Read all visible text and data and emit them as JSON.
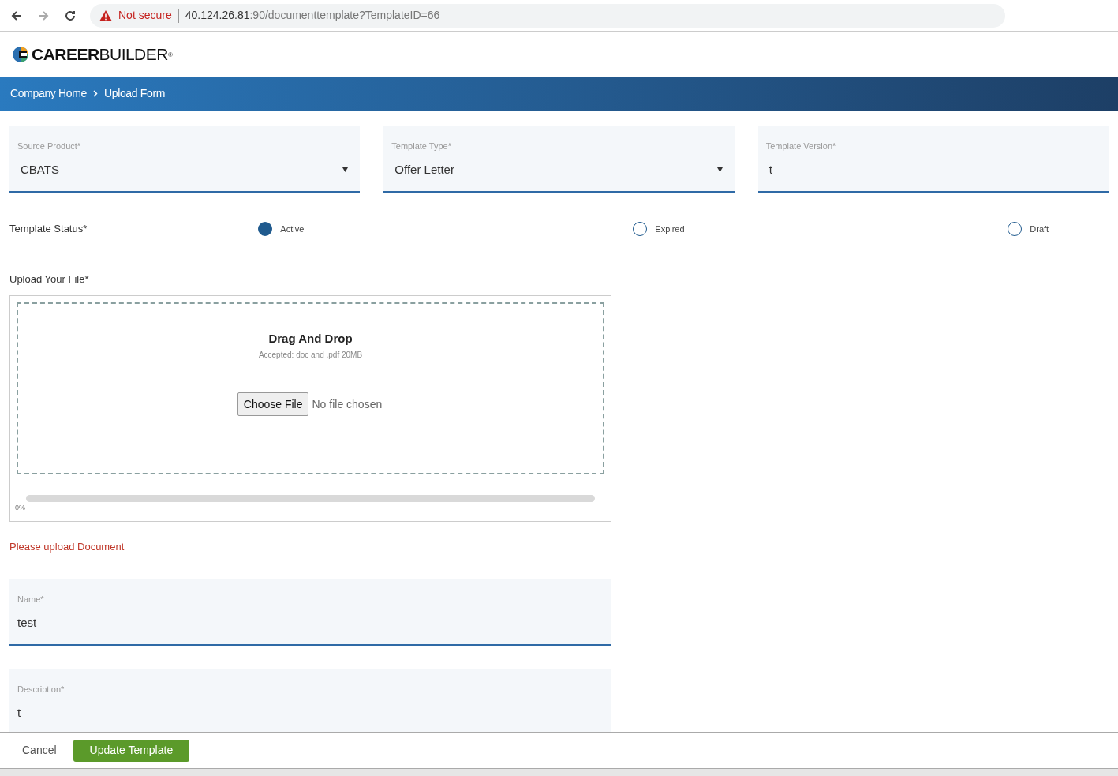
{
  "browser": {
    "security": "Not secure",
    "url_host": "40.124.26.81",
    "url_path": ":90/documenttemplate?TemplateID=66"
  },
  "logo": {
    "bold": "CAREER",
    "light": "BUILDER",
    "mark": "®"
  },
  "breadcrumb": [
    "Company Home",
    "Upload Form"
  ],
  "selects": [
    {
      "label": "Source Product*",
      "value": "CBATS",
      "kind": "dropdown"
    },
    {
      "label": "Template Type*",
      "value": "Offer Letter",
      "kind": "dropdown"
    },
    {
      "label": "Template Version*",
      "value": "t",
      "kind": "text"
    }
  ],
  "status": {
    "label": "Template Status*",
    "options": [
      {
        "label": "Active",
        "selected": true
      },
      {
        "label": "Expired",
        "selected": false
      },
      {
        "label": "Draft",
        "selected": false
      }
    ]
  },
  "upload": {
    "label": "Upload Your File*",
    "title": "Drag And Drop",
    "hint": "Accepted: doc and .pdf 20MB",
    "button": "Choose File",
    "file": "No file chosen",
    "level": 0,
    "percent": "0%",
    "error": "Please upload Document"
  },
  "name_field": {
    "label": "Name*",
    "value": "test"
  },
  "description_field": {
    "label": "Description*",
    "value": "t"
  },
  "footer": {
    "cancel": "Cancel",
    "submit": "Update Template"
  }
}
